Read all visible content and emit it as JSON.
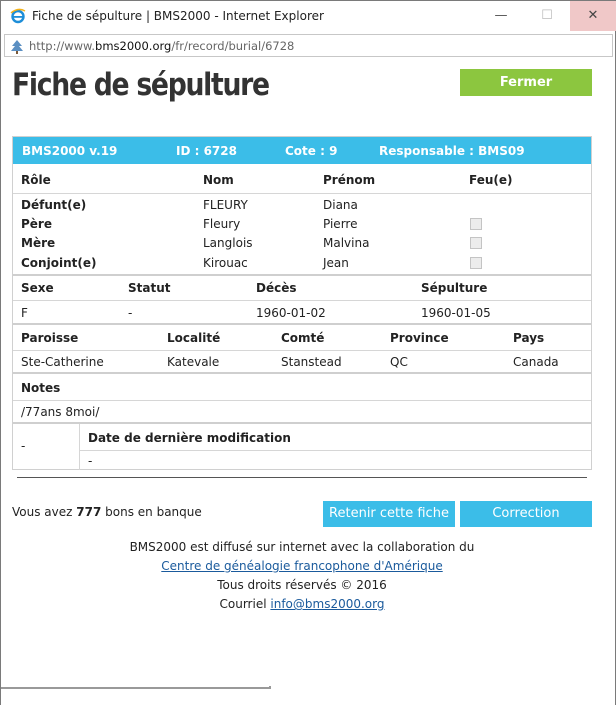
{
  "window": {
    "title": "Fiche de sépulture | BMS2000 - Internet Explorer",
    "address_prefix": "http://www.",
    "address_domain": "bms2000.org",
    "address_suffix": "/fr/record/burial/6728"
  },
  "page": {
    "title": "Fiche de sépulture",
    "close_label": "Fermer"
  },
  "record": {
    "header": {
      "version": "BMS2000 v.19",
      "id": "ID : 6728",
      "cote": "Cote : 9",
      "responsable": "Responsable : BMS09"
    },
    "persons_headers": [
      "Rôle",
      "Nom",
      "Prénom",
      "Feu(e)"
    ],
    "persons": [
      {
        "role": "Défunt(e)",
        "nom": "FLEURY",
        "prenom": "Diana",
        "feu": null
      },
      {
        "role": "Père",
        "nom": "Fleury",
        "prenom": "Pierre",
        "feu": false
      },
      {
        "role": "Mère",
        "nom": "Langlois",
        "prenom": "Malvina",
        "feu": false
      },
      {
        "role": "Conjoint(e)",
        "nom": "Kirouac",
        "prenom": "Jean",
        "feu": false
      }
    ],
    "vital_headers": [
      "Sexe",
      "Statut",
      "Décès",
      "Sépulture"
    ],
    "vital_values": [
      "F",
      "-",
      "1960-01-02",
      "1960-01-05"
    ],
    "place_headers": [
      "Paroisse",
      "Localité",
      "Comté",
      "Province",
      "Pays"
    ],
    "place_values": [
      "Ste-Catherine",
      "Katevale",
      "Stanstead",
      "QC",
      "Canada"
    ],
    "notes_label": "Notes",
    "notes_value": "/77ans 8moi/",
    "modif_left": "-",
    "modif_label": "Date de dernière modification",
    "modif_value": "-"
  },
  "bank": {
    "prefix": "Vous avez",
    "count": "777",
    "suffix": "bons en banque"
  },
  "actions": {
    "retenir_label": "Retenir cette fiche",
    "correction_label": "Correction"
  },
  "footer": {
    "line1": "BMS2000 est diffusé sur internet avec la collaboration du",
    "link1": "Centre de généalogie francophone d'Amérique",
    "line3": "Tous droits réservés © 2016",
    "line4_prefix": "Courriel",
    "email": "info@bms2000.org"
  },
  "colors": {
    "accent_blue": "#3bbde8",
    "close_green": "#8cc63f"
  }
}
